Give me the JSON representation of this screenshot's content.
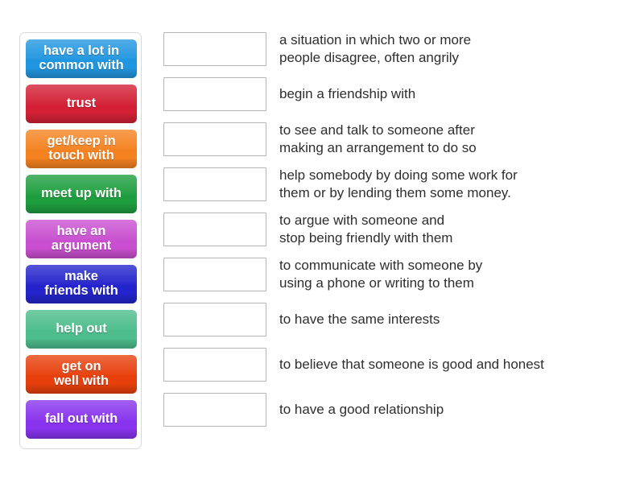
{
  "activity": {
    "type": "match-up",
    "tiles_panel_label": "draggable terms"
  },
  "tiles": [
    {
      "label": "have a lot in\ncommon with",
      "color": "#2196e0",
      "name": "tile-have-a-lot-in-common-with"
    },
    {
      "label": "trust",
      "color": "#d32035",
      "name": "tile-trust"
    },
    {
      "label": "get/keep in\ntouch with",
      "color": "#f58220",
      "name": "tile-get-keep-in-touch-with"
    },
    {
      "label": "meet up with",
      "color": "#1f9e3f",
      "name": "tile-meet-up-with"
    },
    {
      "label": "have an\nargument",
      "color": "#c94fd0",
      "name": "tile-have-an-argument"
    },
    {
      "label": "make\nfriends with",
      "color": "#2424cc",
      "name": "tile-make-friends-with"
    },
    {
      "label": "help out",
      "color": "#4dbd8c",
      "name": "tile-help-out"
    },
    {
      "label": "get on\nwell with",
      "color": "#e8400c",
      "name": "tile-get-on-well-with"
    },
    {
      "label": "fall out with",
      "color": "#8833ee",
      "name": "tile-fall-out-with"
    }
  ],
  "definitions": [
    {
      "text": "a situation in which two or more\npeople disagree, often angrily",
      "answer": ""
    },
    {
      "text": "begin a friendship with",
      "answer": ""
    },
    {
      "text": "to see and talk to someone after\nmaking an arrangement to do so",
      "answer": ""
    },
    {
      "text": "help somebody by doing some work for\nthem or by lending them some money.",
      "answer": ""
    },
    {
      "text": "to argue with someone and\nstop being friendly with them",
      "answer": ""
    },
    {
      "text": "to communicate with someone by\nusing a phone or writing to them",
      "answer": ""
    },
    {
      "text": "to have the same interests",
      "answer": ""
    },
    {
      "text": "to believe that someone is good and honest",
      "answer": ""
    },
    {
      "text": "to have a good relationship",
      "answer": ""
    }
  ],
  "colors": {
    "page_background": "#ffffff",
    "panel_border": "#d8d8d8",
    "slot_border": "#b5b5b5",
    "definition_text": "#2e2e2e",
    "tile_text": "#ffffff"
  }
}
